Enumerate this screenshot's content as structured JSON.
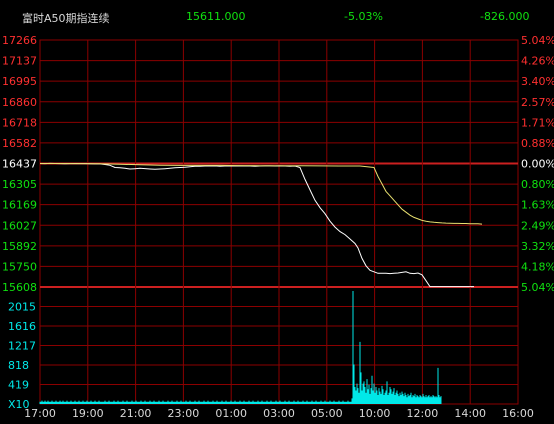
{
  "header": {
    "title": "富时A50期指连续",
    "last_price": "15611.000",
    "change_pct": "-5.03%",
    "change": "-826.000"
  },
  "colors": {
    "up": "#ff3030",
    "down": "#10e010",
    "grid": "#8b0000",
    "price_line": "#ffffff",
    "avg_line": "#e8e070",
    "volume": "#00e8e8",
    "title_text": "#d8d8d8"
  },
  "chart_data": {
    "type": "line",
    "base_price": 16437,
    "price_labels": [
      "17266",
      "17137",
      "16995",
      "16860",
      "16718",
      "16582",
      "16437",
      "16305",
      "16169",
      "16027",
      "15892",
      "15750",
      "15608"
    ],
    "pct_labels": [
      "5.04%",
      "4.26%",
      "3.40%",
      "2.57%",
      "1.71%",
      "0.88%",
      "0.00%",
      "0.80%",
      "1.63%",
      "2.49%",
      "3.32%",
      "4.18%",
      "5.04%"
    ],
    "volume_labels": [
      "2015",
      "1616",
      "1217",
      "818",
      "419",
      "X10"
    ],
    "time_labels": [
      "17:00",
      "19:00",
      "21:00",
      "23:00",
      "01:00",
      "03:00",
      "05:00",
      "10:00",
      "12:00",
      "14:00",
      "16:00"
    ],
    "ylim": [
      15608,
      17266
    ],
    "series": [
      {
        "x": [
          0,
          5,
          10,
          15,
          20,
          25,
          30,
          35,
          40,
          45,
          50,
          55,
          60,
          65,
          70,
          75,
          80,
          85,
          90,
          95,
          100,
          105,
          110,
          115,
          120,
          125,
          130,
          135,
          140,
          145,
          150,
          155,
          160,
          165,
          170,
          175,
          180,
          185,
          190,
          195,
          200,
          205,
          210,
          215,
          220,
          225,
          230,
          235,
          240,
          245,
          250,
          255,
          260,
          265,
          270,
          275,
          280,
          285,
          290,
          295,
          300,
          305,
          310,
          315,
          318,
          322,
          326,
          330,
          334,
          338,
          342,
          346,
          350,
          354,
          358,
          362,
          366,
          370,
          374,
          378,
          382,
          386,
          390,
          394,
          398,
          402,
          406,
          410,
          414,
          418,
          422,
          426,
          430,
          434
        ],
        "values": [
          16437,
          16436,
          16438,
          16437,
          16436,
          16435,
          16436,
          16437,
          16436,
          16436,
          16435,
          16434,
          16434,
          16430,
          16425,
          16410,
          16408,
          16405,
          16400,
          16402,
          16405,
          16403,
          16400,
          16398,
          16400,
          16402,
          16405,
          16408,
          16410,
          16412,
          16415,
          16418,
          16418,
          16420,
          16420,
          16421,
          16419,
          16420,
          16421,
          16420,
          16421,
          16420,
          16420,
          16419,
          16420,
          16421,
          16421,
          16420,
          16421,
          16420,
          16419,
          16420,
          16410,
          16330,
          16260,
          16190,
          16140,
          16100,
          16050,
          16010,
          15980,
          15960,
          15930,
          15900,
          15870,
          15800,
          15750,
          15720,
          15710,
          15700,
          15700,
          15700,
          15698,
          15700,
          15702,
          15706,
          15710,
          15700,
          15698,
          15702,
          15690,
          15650,
          15611,
          15611,
          15611,
          15611,
          15611,
          15611,
          15611,
          15611,
          15611,
          15611,
          15611,
          15611
        ]
      },
      {
        "x": [
          0,
          20,
          40,
          60,
          80,
          100,
          120,
          140,
          160,
          180,
          200,
          220,
          240,
          260,
          280,
          300,
          320,
          334,
          338,
          342,
          346,
          350,
          354,
          358,
          362,
          366,
          370,
          374,
          378,
          382,
          386,
          390,
          394,
          398,
          402,
          406,
          410,
          414,
          418,
          422,
          426,
          430,
          434,
          438,
          442
        ],
        "values": [
          16437,
          16437,
          16436,
          16435,
          16432,
          16428,
          16425,
          16424,
          16424,
          16424,
          16423,
          16422,
          16422,
          16422,
          16421,
          16420,
          16420,
          16410,
          16350,
          16300,
          16250,
          16220,
          16190,
          16160,
          16130,
          16110,
          16090,
          16075,
          16065,
          16055,
          16050,
          16045,
          16042,
          16040,
          16038,
          16037,
          16036,
          16035,
          16035,
          16034,
          16034,
          16033,
          16033,
          16033,
          16030
        ]
      }
    ],
    "volume": [
      0.02,
      0.02,
      0.03,
      0.02,
      0.02,
      0.03,
      0.02,
      0.02,
      0.03,
      0.02,
      0.02,
      0.02,
      0.03,
      0.02,
      0.02,
      0.02,
      0.03,
      0.02,
      0.02,
      0.02,
      0.03,
      0.02,
      0.02,
      0.03,
      0.02,
      0.02,
      0.02,
      0.03,
      0.02,
      0.02,
      0.02,
      0.03,
      0.02,
      0.02,
      0.02,
      0.03,
      0.02,
      0.02,
      0.02,
      0.03,
      0.02,
      0.02,
      0.02,
      0.03,
      0.02,
      0.02,
      0.02,
      0.03,
      0.02,
      0.02,
      0.02,
      0.03,
      0.02,
      0.02,
      0.02,
      0.03,
      0.02,
      0.02,
      0.02,
      0.03,
      0.02,
      0.02,
      0.02,
      0.02,
      0.02,
      0.03,
      0.02,
      0.02,
      0.02,
      0.03,
      0.02,
      0.02,
      0.02,
      0.02,
      0.03,
      0.02,
      0.02,
      0.02,
      0.03,
      0.02,
      0.02,
      0.02,
      0.02,
      0.03,
      0.02,
      0.02,
      0.02,
      0.03,
      0.02,
      0.02,
      0.02,
      0.02,
      0.03,
      0.02,
      0.02,
      0.02,
      0.03,
      0.02,
      0.02,
      0.02,
      0.02,
      0.03,
      0.02,
      0.02,
      0.02,
      0.03,
      0.02,
      0.02,
      0.02,
      0.02,
      0.03,
      0.02,
      0.02,
      0.02,
      0.03,
      0.02,
      0.02,
      0.02,
      0.02,
      0.03,
      0.02,
      0.02,
      0.02,
      0.03,
      0.02,
      0.02,
      0.02,
      0.02,
      0.03,
      0.02,
      0.02,
      0.02,
      0.03,
      0.02,
      0.02,
      0.02,
      0.02,
      0.03,
      0.02,
      0.02,
      0.02,
      0.03,
      0.02,
      0.02,
      0.02,
      0.02,
      0.03,
      0.02,
      0.02,
      0.02,
      0.03,
      0.02,
      0.02,
      0.02,
      0.02,
      0.03,
      0.02,
      0.02,
      0.02,
      0.03,
      0.02,
      0.02,
      0.02,
      0.02,
      0.03,
      0.02,
      0.02,
      0.02,
      0.03,
      0.02,
      0.02,
      0.02,
      0.02,
      0.03,
      0.02,
      0.02,
      0.02,
      0.03,
      0.02,
      0.02,
      0.02,
      0.02,
      0.03,
      0.02,
      0.02,
      0.02,
      0.03,
      0.02,
      0.02,
      0.02,
      0.02,
      0.03,
      0.02,
      0.02,
      0.02,
      0.03,
      0.02,
      0.02,
      0.02,
      0.02,
      0.03,
      0.02,
      0.02,
      0.02,
      0.03,
      0.02,
      0.02,
      0.02,
      0.02,
      0.03,
      0.02,
      0.02,
      0.02,
      0.03,
      0.02,
      0.02,
      0.02,
      0.02,
      0.03,
      0.02,
      0.02,
      0.02,
      0.03,
      0.02,
      0.02,
      0.02,
      0.02,
      0.03,
      0.02,
      0.02,
      0.02,
      0.03,
      0.02,
      0.02,
      0.02,
      0.02,
      0.03,
      0.02,
      0.02,
      0.02,
      0.03,
      0.02,
      0.02,
      0.02,
      0.02,
      0.03,
      0.02,
      0.02,
      0.02,
      0.03,
      0.02,
      0.02,
      0.02,
      0.02,
      0.03,
      0.02,
      0.02,
      0.02,
      0.03,
      0.02,
      0.02,
      0.02,
      0.02,
      0.03,
      0.02,
      0.02,
      0.02,
      0.03,
      0.02,
      0.02,
      0.02,
      0.02,
      0.03,
      0.02,
      0.02,
      0.02,
      0.03,
      0.02,
      0.02,
      0.02,
      0.02,
      0.03,
      0.02,
      0.02,
      0.02,
      0.03,
      0.02,
      0.02,
      0.02,
      0.02,
      0.03,
      0.02,
      0.02,
      0.02,
      0.03,
      0.02,
      0.02,
      0.02,
      0.02,
      0.03,
      0.02,
      0.02,
      0.02,
      0.03,
      0.02,
      0.02,
      0.02,
      0.02,
      0.03,
      0.02,
      0.02,
      0.02,
      0.05,
      1.0,
      0.35,
      0.15,
      0.12,
      0.18,
      0.14,
      0.1,
      0.55,
      0.28,
      0.12,
      0.18,
      0.2,
      0.15,
      0.1,
      0.22,
      0.13,
      0.17,
      0.09,
      0.14,
      0.25,
      0.12,
      0.18,
      0.1,
      0.15,
      0.12,
      0.08,
      0.14,
      0.11,
      0.09,
      0.16,
      0.13,
      0.08,
      0.1,
      0.12,
      0.2,
      0.08,
      0.1,
      0.15,
      0.13,
      0.09,
      0.11,
      0.14,
      0.08,
      0.1,
      0.12,
      0.09,
      0.07,
      0.1,
      0.08,
      0.11,
      0.09,
      0.07,
      0.1,
      0.08,
      0.06,
      0.09,
      0.07,
      0.08,
      0.1,
      0.06,
      0.08,
      0.07,
      0.09,
      0.06,
      0.08,
      0.07,
      0.06,
      0.08,
      0.07,
      0.06,
      0.09,
      0.07,
      0.06,
      0.08,
      0.06,
      0.07,
      0.08,
      0.06,
      0.07,
      0.06,
      0.08,
      0.07,
      0.06,
      0.07,
      0.06,
      0.32,
      0.08,
      0.06,
      0.07
    ]
  }
}
